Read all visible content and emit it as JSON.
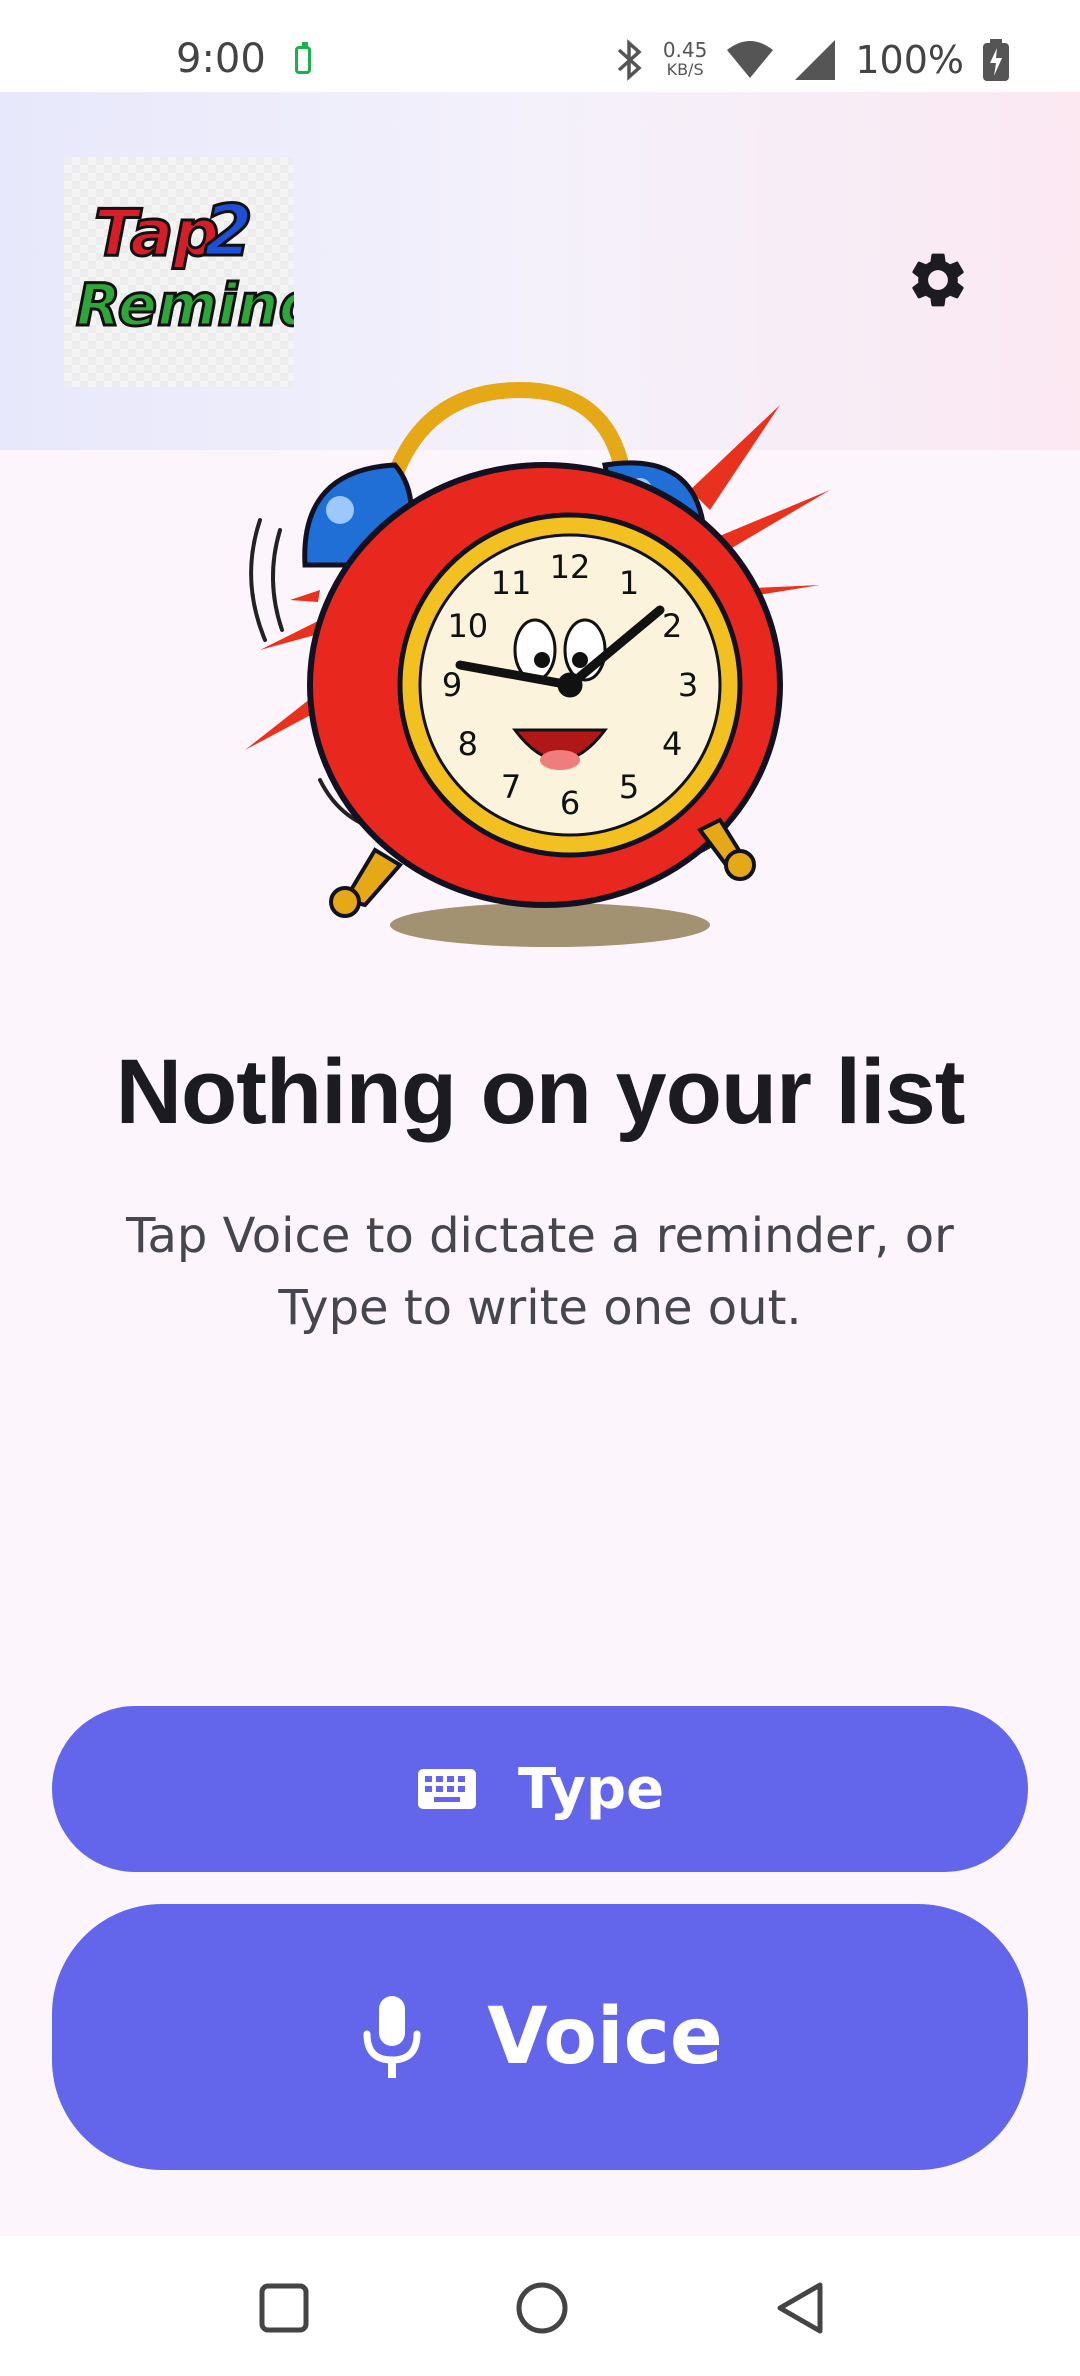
{
  "status_bar": {
    "time": "9:00",
    "net_speed_value": "0.45",
    "net_speed_unit": "KB/S",
    "battery_percent": "100%"
  },
  "header": {
    "logo_line1": "Tap2",
    "logo_line2": "Remind",
    "settings_icon": "gear-icon"
  },
  "illustration": {
    "icon": "alarm-clock-illustration",
    "clock_numbers": [
      "12",
      "1",
      "2",
      "3",
      "4",
      "5",
      "6",
      "7",
      "8",
      "9",
      "10",
      "11"
    ]
  },
  "empty_state": {
    "title": "Nothing on your list",
    "subtitle": "Tap Voice to dictate a reminder, or Type to write one out."
  },
  "actions": {
    "type_label": "Type",
    "type_icon": "keyboard-icon",
    "voice_label": "Voice",
    "voice_icon": "microphone-icon"
  },
  "nav": {
    "recents_icon": "square-icon",
    "home_icon": "circle-icon",
    "back_icon": "triangle-back-icon"
  },
  "colors": {
    "accent": "#6366ea",
    "background": "#fcf6fc",
    "title": "#1b1b21",
    "subtitle": "#46464f"
  }
}
